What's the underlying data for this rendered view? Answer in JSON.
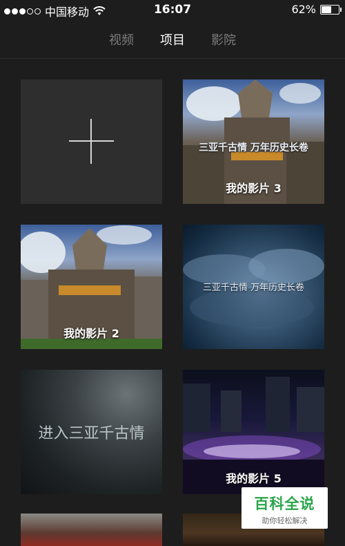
{
  "status_bar": {
    "carrier": "中国移动",
    "time": "16:07",
    "battery_text": "62%",
    "battery_level": 0.62,
    "signal_dots_filled": 3,
    "signal_dots_total": 5
  },
  "tabs": [
    {
      "label": "视频",
      "active": false
    },
    {
      "label": "项目",
      "active": true
    },
    {
      "label": "影院",
      "active": false
    }
  ],
  "tiles": {
    "project3_overlay_title": "三亚千古情  万年历史长卷",
    "project3_label": "我的影片 3",
    "project2_label": "我的影片 2",
    "template_title": "三亚千古情  万年历史长卷",
    "enter_text": "进入三亚千古情",
    "project5_label": "我的影片 5"
  },
  "watermark": {
    "title": "百科全说",
    "subtitle": "助你轻松解决"
  },
  "colors": {
    "background": "#1d1d1d",
    "tab_active": "#ffffff",
    "tab_inactive": "#7d7d7d",
    "watermark_green": "#2aa54a"
  }
}
